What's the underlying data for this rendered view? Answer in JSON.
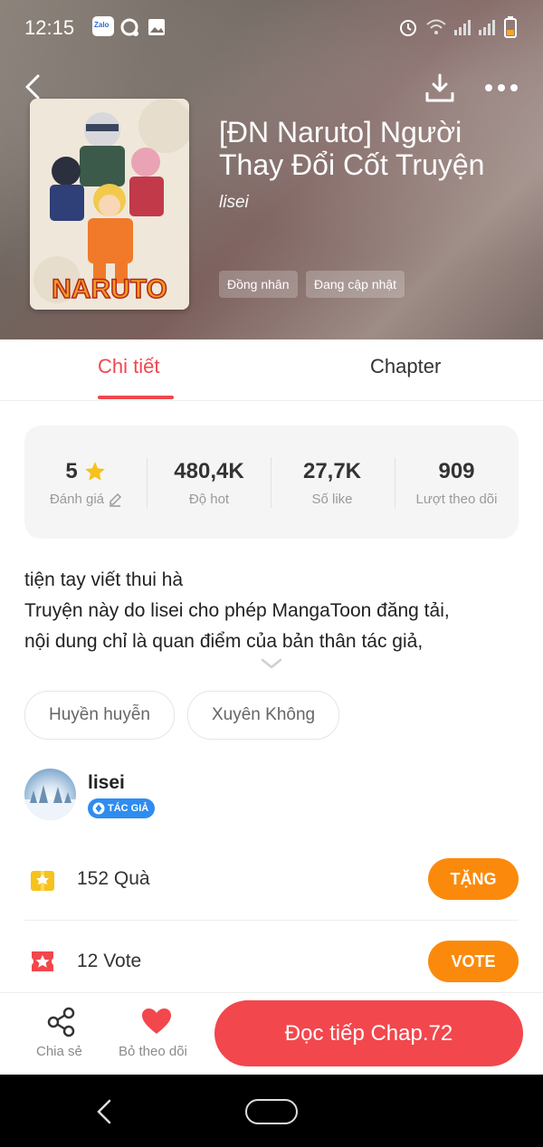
{
  "status_bar": {
    "time": "12:15",
    "zalo_label": "Zalo"
  },
  "book": {
    "title": "[ĐN Naruto] Người Thay Đổi Cốt Truyện",
    "author": "lisei",
    "tags": [
      "Đồng nhân",
      "Đang cập nhật"
    ],
    "cover_logo": "NARUTO"
  },
  "tabs": {
    "details": "Chi tiết",
    "chapter": "Chapter"
  },
  "stats": [
    {
      "value": "5",
      "label": "Đánh giá"
    },
    {
      "value": "480,4K",
      "label": "Độ hot"
    },
    {
      "value": "27,7K",
      "label": "Số like"
    },
    {
      "value": "909",
      "label": "Lượt theo dõi"
    }
  ],
  "description": {
    "line1": "tiện tay viết thui hà",
    "line2": "Truyện này do lisei cho phép MangaToon đăng tải,",
    "line3": "nội dung chỉ là quan điểm của bản thân tác giả,"
  },
  "genres": [
    "Huyền huyễn",
    "Xuyên Không"
  ],
  "author_card": {
    "name": "lisei",
    "badge": "TÁC GIẢ"
  },
  "gifts": {
    "text": "152  Quà",
    "button": "TẶNG"
  },
  "votes": {
    "text": "12  Vote",
    "button": "VOTE"
  },
  "bottom_bar": {
    "share_label": "Chia sẻ",
    "unfollow_label": "Bỏ theo dõi",
    "read_button": "Đọc tiếp Chap.72"
  },
  "colors": {
    "accent": "#f0474e",
    "orange": "#fb8a0c",
    "star": "#f7c21b",
    "badge_blue": "#2f8cf0"
  }
}
